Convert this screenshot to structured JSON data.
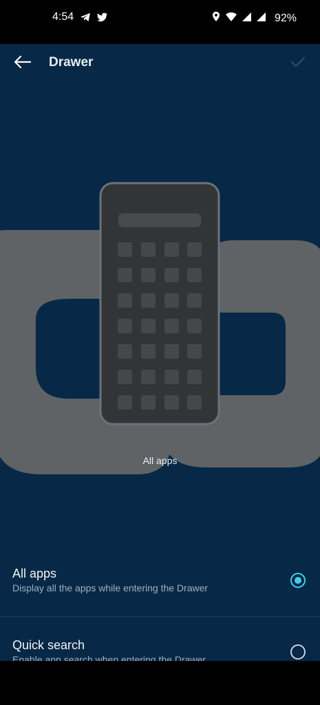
{
  "status_bar": {
    "time": "4:54",
    "left_icons": [
      "telegram-icon",
      "twitter-icon"
    ],
    "right_icons": [
      "location-icon",
      "wifi-icon",
      "signal-icon",
      "signal-icon"
    ],
    "battery": "92%"
  },
  "app_bar": {
    "title": "Drawer",
    "back_icon": "arrow-left-icon",
    "confirm_icon": "check-icon"
  },
  "preview": {
    "caption": "All apps"
  },
  "options": [
    {
      "title": "All apps",
      "description": "Display all the apps while entering the Drawer",
      "selected": true
    },
    {
      "title": "Quick search",
      "description": "Enable app search when entering the Drawer",
      "selected": false
    }
  ],
  "colors": {
    "background": "#072846",
    "accent": "#3fd0ee",
    "logo_gray": "#5f6366"
  }
}
